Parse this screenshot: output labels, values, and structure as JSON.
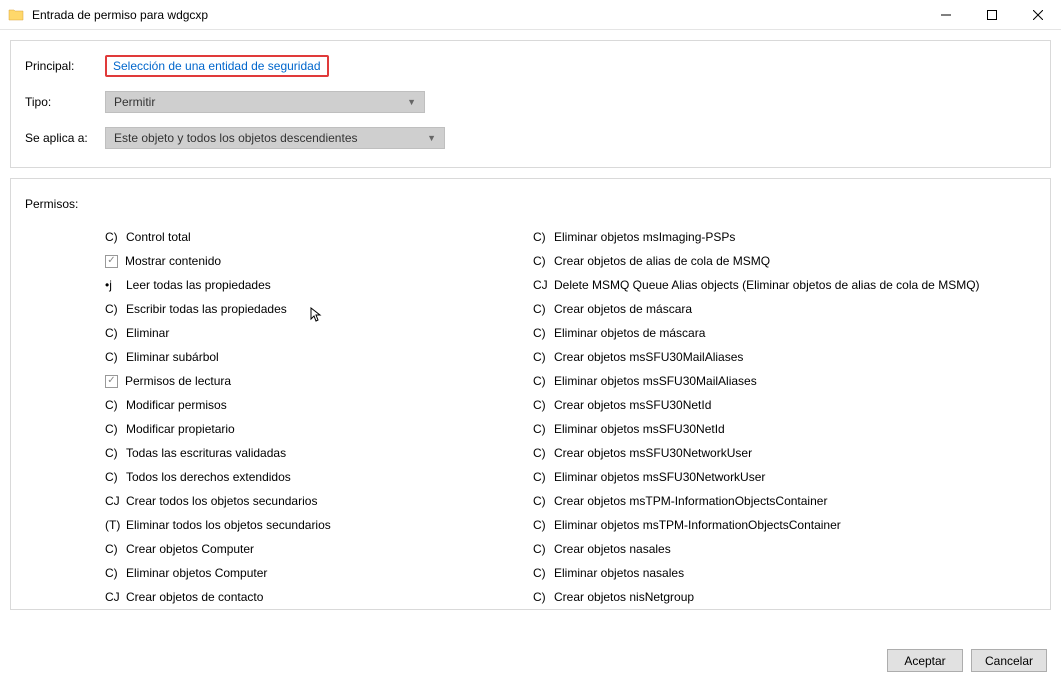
{
  "window": {
    "title": "Entrada de permiso para wdgcxp"
  },
  "fields": {
    "principal_label": "Principal:",
    "principal_link": "Selección de una entidad de seguridad",
    "type_label": "Tipo:",
    "type_value": "Permitir",
    "applies_label": "Se aplica a:",
    "applies_value": "Este objeto y todos los objetos descendientes"
  },
  "permissions_label": "Permisos:",
  "permissions_left": [
    {
      "prefix": "C)",
      "text": "Control total",
      "checked": false,
      "box": false
    },
    {
      "prefix": "",
      "text": "Mostrar contenido",
      "checked": true,
      "box": true
    },
    {
      "prefix": "•j",
      "text": "Leer todas las propiedades",
      "checked": false,
      "box": false
    },
    {
      "prefix": "C)",
      "text": "Escribir todas las propiedades",
      "checked": false,
      "box": false
    },
    {
      "prefix": "C)",
      "text": "Eliminar",
      "checked": false,
      "box": false
    },
    {
      "prefix": "C)",
      "text": "Eliminar subárbol",
      "checked": false,
      "box": false
    },
    {
      "prefix": "",
      "text": "Permisos de lectura",
      "checked": true,
      "box": true
    },
    {
      "prefix": "C)",
      "text": "Modificar permisos",
      "checked": false,
      "box": false
    },
    {
      "prefix": "C)",
      "text": "Modificar propietario",
      "checked": false,
      "box": false
    },
    {
      "prefix": "C)",
      "text": "Todas las escrituras validadas",
      "checked": false,
      "box": false
    },
    {
      "prefix": "C)",
      "text": "Todos los derechos extendidos",
      "checked": false,
      "box": false
    },
    {
      "prefix": "CJ",
      "text": "Crear todos los objetos secundarios",
      "checked": false,
      "box": false
    },
    {
      "prefix": "(T)",
      "text": "Eliminar todos los objetos secundarios",
      "checked": false,
      "box": false
    },
    {
      "prefix": "C)",
      "text": "Crear objetos Computer",
      "checked": false,
      "box": false
    },
    {
      "prefix": "C)",
      "text": "Eliminar objetos Computer",
      "checked": false,
      "box": false
    },
    {
      "prefix": "CJ",
      "text": "Crear objetos de contacto",
      "checked": false,
      "box": false
    }
  ],
  "permissions_right": [
    {
      "prefix": "C)",
      "text": "Eliminar objetos msImaging-PSPs",
      "checked": false,
      "box": false
    },
    {
      "prefix": "C)",
      "text": "Crear objetos de alias de cola de MSMQ",
      "checked": false,
      "box": false
    },
    {
      "prefix": "CJ",
      "text": "Delete MSMQ Queue Alias objects (Eliminar objetos de alias de cola de MSMQ)",
      "checked": false,
      "box": false
    },
    {
      "prefix": "C)",
      "text": "Crear objetos de máscara",
      "checked": false,
      "box": false
    },
    {
      "prefix": "C)",
      "text": "Eliminar objetos de máscara",
      "checked": false,
      "box": false
    },
    {
      "prefix": "C)",
      "text": "Crear objetos msSFU30MailAliases",
      "checked": false,
      "box": false
    },
    {
      "prefix": "C)",
      "text": "Eliminar objetos msSFU30MailAliases",
      "checked": false,
      "box": false
    },
    {
      "prefix": "C)",
      "text": "Crear objetos msSFU30NetId",
      "checked": false,
      "box": false
    },
    {
      "prefix": "C)",
      "text": "Eliminar objetos msSFU30NetId",
      "checked": false,
      "box": false
    },
    {
      "prefix": "C)",
      "text": "Crear objetos msSFU30NetworkUser",
      "checked": false,
      "box": false
    },
    {
      "prefix": "C)",
      "text": "Eliminar objetos msSFU30NetworkUser",
      "checked": false,
      "box": false
    },
    {
      "prefix": "C)",
      "text": "Crear objetos msTPM-InformationObjectsContainer",
      "checked": false,
      "box": false
    },
    {
      "prefix": "C)",
      "text": "Eliminar objetos msTPM-InformationObjectsContainer",
      "checked": false,
      "box": false
    },
    {
      "prefix": "C)",
      "text": "Crear objetos nasales",
      "checked": false,
      "box": false
    },
    {
      "prefix": "C)",
      "text": "Eliminar objetos nasales",
      "checked": false,
      "box": false
    },
    {
      "prefix": "C)",
      "text": "Crear objetos nisNetgroup",
      "checked": false,
      "box": false
    }
  ],
  "buttons": {
    "ok": "Aceptar",
    "cancel": "Cancelar"
  }
}
